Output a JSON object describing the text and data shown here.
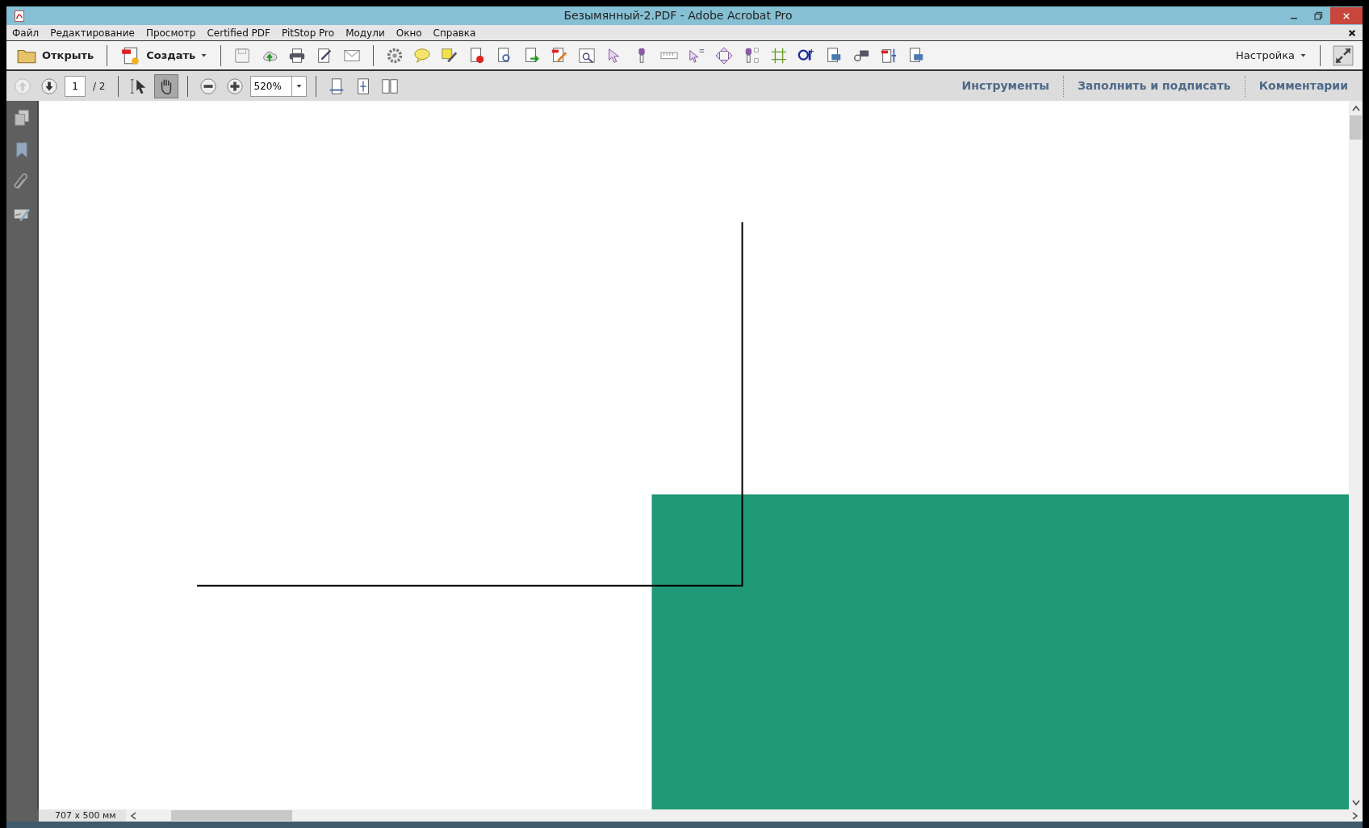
{
  "window": {
    "title": "Безымянный-2.PDF - Adobe Acrobat Pro"
  },
  "menu": [
    "Файл",
    "Редактирование",
    "Просмотр",
    "Certified PDF",
    "PitStop Pro",
    "Модули",
    "Окно",
    "Справка"
  ],
  "toolbar": {
    "open": "Открыть",
    "create": "Создать",
    "customize": "Настройка"
  },
  "navigation": {
    "page": "1",
    "page_count": "/ 2",
    "zoom": "520%",
    "tools": [
      {
        "kind": "select",
        "selected": false
      },
      {
        "kind": "hand",
        "selected": true
      }
    ]
  },
  "panes": [
    "Инструменты",
    "Заполнить и подписать",
    "Комментарии"
  ],
  "status_bar": {
    "page_size": "707 x 500 мм"
  }
}
